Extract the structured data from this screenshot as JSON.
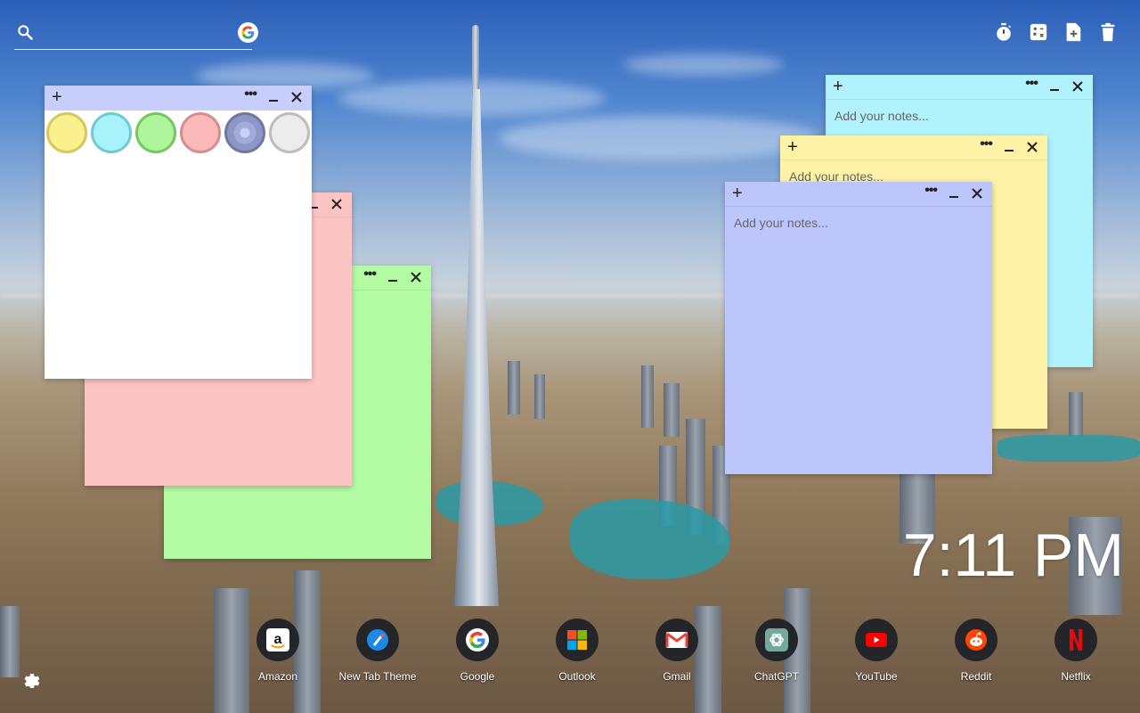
{
  "search": {
    "placeholder": "",
    "value": ""
  },
  "top_tools": [
    "timer-icon",
    "calculator-icon",
    "add-file-icon",
    "trash-icon"
  ],
  "notes": {
    "placeholder": "Add your notes...",
    "colors": {
      "white": "#ffffff",
      "pink": "#fdc4c4",
      "green": "#b3fba2",
      "cyan": "#b0f3fd",
      "yellow": "#fdf2a5",
      "blue": "#bdc6fb"
    },
    "color_picker": [
      {
        "name": "yellow",
        "fill": "#fbf08e",
        "ring": "#d6c85c"
      },
      {
        "name": "cyan",
        "fill": "#a8f2fb",
        "ring": "#72c9d5"
      },
      {
        "name": "green",
        "fill": "#aef59b",
        "ring": "#74c762"
      },
      {
        "name": "pink",
        "fill": "#fbb9b9",
        "ring": "#d58d8d"
      },
      {
        "name": "blue",
        "fill": "#8d97c6",
        "ring": "#6f78a3",
        "selected": true
      },
      {
        "name": "grey",
        "fill": "#ececec",
        "ring": "#bdbdbd"
      }
    ]
  },
  "clock": {
    "time": "7:11 PM"
  },
  "shortcuts": [
    {
      "label": "Amazon",
      "icon": "amazon-icon"
    },
    {
      "label": "New Tab Theme",
      "icon": "new-tab-theme-icon"
    },
    {
      "label": "Google",
      "icon": "google-icon"
    },
    {
      "label": "Outlook",
      "icon": "outlook-icon"
    },
    {
      "label": "Gmail",
      "icon": "gmail-icon"
    },
    {
      "label": "ChatGPT",
      "icon": "chatgpt-icon"
    },
    {
      "label": "YouTube",
      "icon": "youtube-icon"
    },
    {
      "label": "Reddit",
      "icon": "reddit-icon"
    },
    {
      "label": "Netflix",
      "icon": "netflix-icon"
    }
  ]
}
